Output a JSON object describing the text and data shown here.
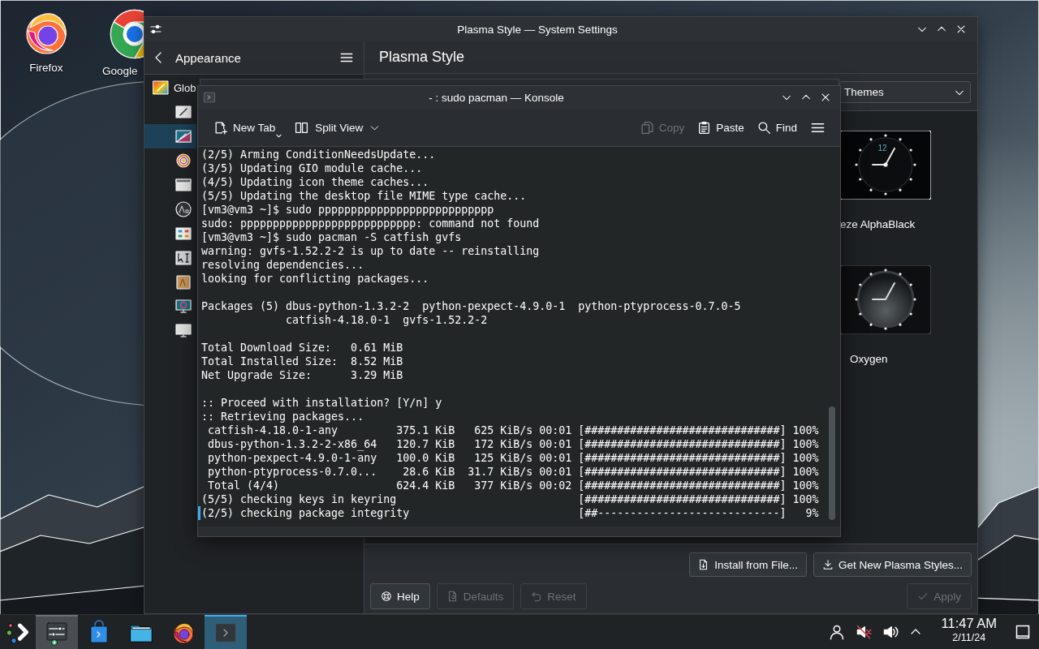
{
  "desktop": {
    "icons": [
      {
        "label": "Firefox",
        "kind": "firefox"
      },
      {
        "label": "Google",
        "kind": "chrome"
      }
    ]
  },
  "settings_window": {
    "title": "Plasma Style — System Settings",
    "sidebar": {
      "header": "Appearance",
      "items": [
        {
          "label": "Glob",
          "kind": "global-theme",
          "selected": false
        },
        {
          "kind": "colors",
          "selected": false
        },
        {
          "kind": "plasma-style",
          "selected": true
        },
        {
          "kind": "application-style",
          "selected": false
        },
        {
          "kind": "window-decorations",
          "selected": false
        },
        {
          "kind": "fonts",
          "selected": false
        },
        {
          "kind": "icons",
          "selected": false
        },
        {
          "kind": "cursors",
          "selected": false
        },
        {
          "kind": "font-management",
          "selected": false
        },
        {
          "kind": "splash-screen",
          "selected": false
        },
        {
          "kind": "login-screen",
          "selected": false
        }
      ]
    },
    "page_title": "Plasma Style",
    "filter": {
      "value": "Themes"
    },
    "themes": [
      {
        "name": "eze AlphaBlack",
        "kind": "dark-clock",
        "numeral": "12"
      },
      {
        "name": "Oxygen",
        "kind": "glass-clock"
      }
    ],
    "actions": [
      {
        "label": "Install from File...",
        "kind": "install"
      },
      {
        "label": "Get New Plasma Styles...",
        "kind": "download"
      }
    ],
    "footer": [
      {
        "label": "Help",
        "kind": "help",
        "disabled": false
      },
      {
        "label": "Defaults",
        "kind": "defaults",
        "disabled": true
      },
      {
        "label": "Reset",
        "kind": "reset",
        "disabled": true
      },
      {
        "label": "Apply",
        "kind": "apply",
        "disabled": true
      }
    ]
  },
  "konsole_window": {
    "title": "- : sudo pacman — Konsole",
    "toolbar": [
      {
        "label": "New Tab",
        "kind": "new-tab",
        "disabled": false
      },
      {
        "label": "Split View",
        "kind": "split-view",
        "disabled": false
      },
      {
        "label": "Copy",
        "kind": "copy",
        "disabled": true
      },
      {
        "label": "Paste",
        "kind": "paste",
        "disabled": false
      },
      {
        "label": "Find",
        "kind": "find",
        "disabled": false
      }
    ],
    "terminal_output": "(2/5) Arming ConditionNeedsUpdate...\n(3/5) Updating GIO module cache...\n(4/5) Updating icon theme caches...\n(5/5) Updating the desktop file MIME type cache...\n[vm3@vm3 ~]$ sudo ppppppppppppppppppppppppppp\nsudo: ppppppppppppppppppppppppppp: command not found\n[vm3@vm3 ~]$ sudo pacman -S catfish gvfs\nwarning: gvfs-1.52.2-2 is up to date -- reinstalling\nresolving dependencies...\nlooking for conflicting packages...\n\nPackages (5) dbus-python-1.3.2-2  python-pexpect-4.9.0-1  python-ptyprocess-0.7.0-5\n             catfish-4.18.0-1  gvfs-1.52.2-2\n\nTotal Download Size:   0.61 MiB\nTotal Installed Size:  8.52 MiB\nNet Upgrade Size:      3.29 MiB\n\n:: Proceed with installation? [Y/n] y\n:: Retrieving packages...\n catfish-4.18.0-1-any         375.1 KiB   625 KiB/s 00:01 [##############################] 100%\n dbus-python-1.3.2-2-x86_64   120.7 KiB   172 KiB/s 00:01 [##############################] 100%\n python-pexpect-4.9.0-1-any   100.0 KiB   125 KiB/s 00:01 [##############################] 100%\n python-ptyprocess-0.7.0...    28.6 KiB  31.7 KiB/s 00:01 [##############################] 100%\n Total (4/4)                  624.4 KiB   377 KiB/s 00:02 [##############################] 100%\n(5/5) checking keys in keyring                            [##############################] 100%\n(2/5) checking package integrity                          [##----------------------------]   9%"
  },
  "taskbar": {
    "tasks": [
      {
        "kind": "launcher",
        "selected": false,
        "highlighted": false
      },
      {
        "kind": "settings",
        "selected": false,
        "highlighted": true
      },
      {
        "kind": "discover",
        "selected": false,
        "highlighted": false
      },
      {
        "kind": "files",
        "selected": false,
        "highlighted": false
      },
      {
        "kind": "firefox",
        "selected": false,
        "highlighted": false
      },
      {
        "kind": "konsole",
        "selected": true,
        "highlighted": false
      }
    ],
    "clock": {
      "time": "11:47 AM",
      "date": "2/11/24"
    }
  }
}
